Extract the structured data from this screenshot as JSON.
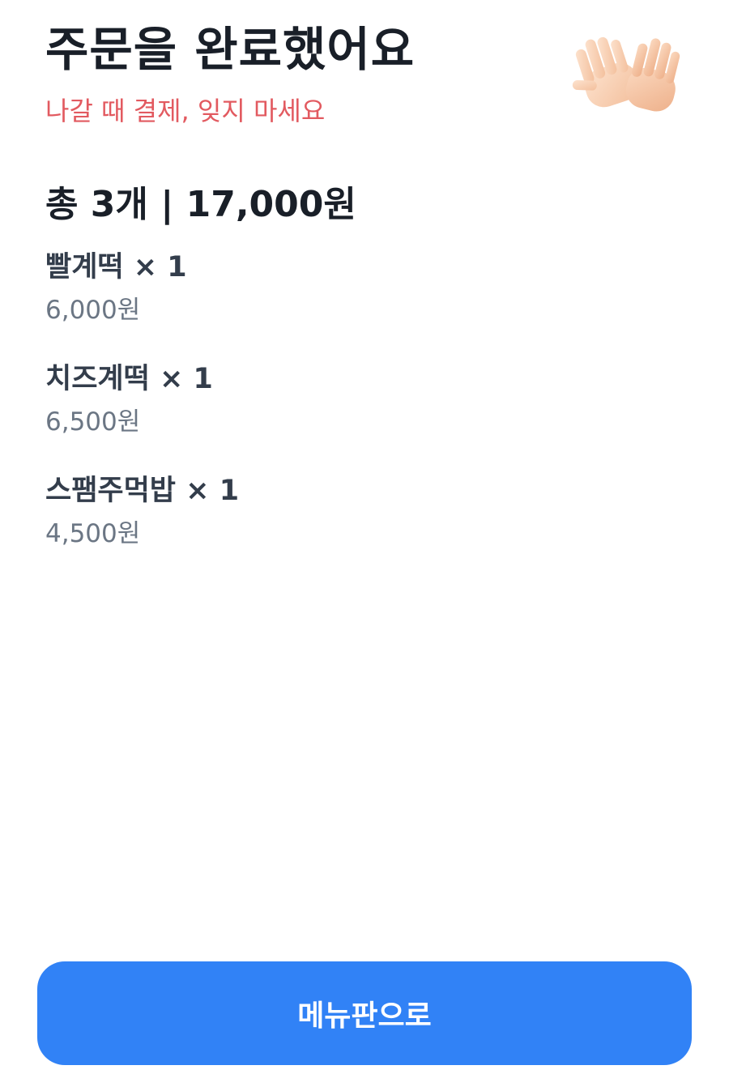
{
  "header": {
    "title": "주문을 완료했어요",
    "subtitle": "나갈 때 결제, 잊지 마세요",
    "icon": "waving-hands-icon"
  },
  "summary": {
    "text": "총 3개 | 17,000원"
  },
  "items": [
    {
      "name": "빨계떡 × 1",
      "price": "6,000원"
    },
    {
      "name": "치즈계떡 × 1",
      "price": "6,500원"
    },
    {
      "name": "스팸주먹밥 × 1",
      "price": "4,500원"
    }
  ],
  "footer": {
    "button_label": "메뉴판으로"
  },
  "colors": {
    "accent": "#3182f6",
    "warning_text": "#e25a60",
    "title_text": "#191f28",
    "secondary_text": "#6b7684"
  }
}
